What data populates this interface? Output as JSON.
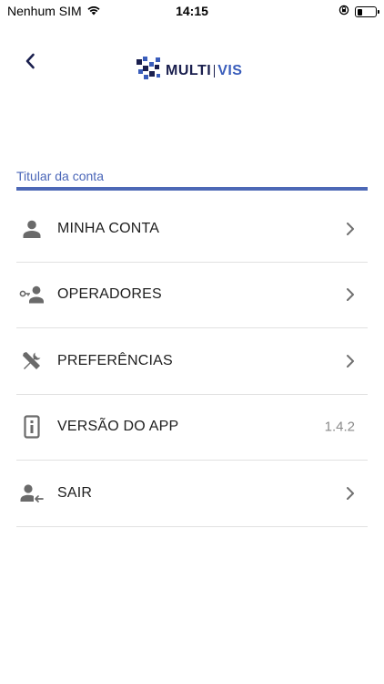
{
  "status_bar": {
    "carrier": "Nenhum SIM",
    "time": "14:15",
    "battery_level": 0.25
  },
  "header": {
    "logo_multi": "MULTI",
    "logo_vis": "VIS",
    "brand_colors": {
      "dark": "#1a1f4e",
      "accent": "#3a5dbb"
    }
  },
  "section": {
    "title": "Titular da conta",
    "accent_color": "#4d68b6"
  },
  "menu": {
    "items": [
      {
        "label": "MINHA CONTA",
        "icon": "person-icon"
      },
      {
        "label": "OPERADORES",
        "icon": "operator-key-icon"
      },
      {
        "label": "PREFERÊNCIAS",
        "icon": "tools-icon"
      },
      {
        "label": "VERSÃO DO APP",
        "icon": "info-icon",
        "value": "1.4.2"
      },
      {
        "label": "SAIR",
        "icon": "logout-icon"
      }
    ]
  }
}
